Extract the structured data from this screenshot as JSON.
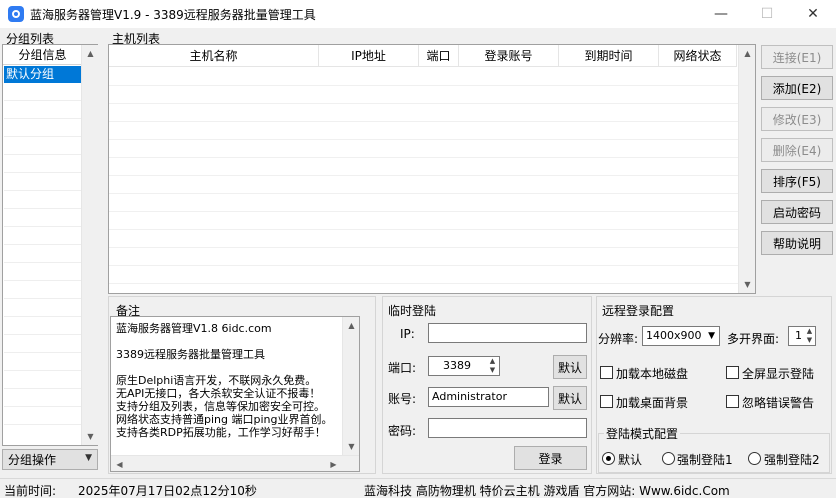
{
  "window": {
    "title": "蓝海服务器管理V1.9 - 3389远程服务器批量管理工具",
    "minimize": "—",
    "maximize": "☐",
    "close": "✕"
  },
  "groups": {
    "section_label": "分组列表",
    "column_header": "分组信息",
    "items": [
      "默认分组"
    ],
    "ops_label": "分组操作"
  },
  "hosts": {
    "section_label": "主机列表",
    "columns": [
      "主机名称",
      "IP地址",
      "端口",
      "登录账号",
      "到期时间",
      "网络状态"
    ]
  },
  "actions": {
    "connect": "连接(E1)",
    "add": "添加(E2)",
    "edit": "修改(E3)",
    "delete": "删除(E4)",
    "sort": "排序(F5)",
    "boot_password": "启动密码",
    "help": "帮助说明"
  },
  "notes": {
    "label": "备注",
    "lines": [
      "蓝海服务器管理V1.8 6idc.com",
      "",
      "3389远程服务器批量管理工具",
      "",
      "原生Delphi语言开发，不联网永久免费。",
      "无API无接口，各大杀软安全认证不报毒！",
      "支持分组及列表，信息等保加密安全可控。",
      "网络状态支持普通ping 端口ping业界首创。",
      "支持各类RDP拓展功能，工作学习好帮手！"
    ]
  },
  "temp_login": {
    "label": "临时登陆",
    "ip_label": "IP:",
    "ip_value": "",
    "port_label": "端口:",
    "port_value": "3389",
    "account_label": "账号:",
    "account_value": "Administrator",
    "password_label": "密码:",
    "password_value": "",
    "default_btn": "默认",
    "login_btn": "登录"
  },
  "remote_config": {
    "label": "远程登录配置",
    "resolution_label": "分辨率:",
    "resolution_value": "1400x900",
    "multi_label": "多开界面:",
    "multi_value": "1",
    "load_disk": "加载本地磁盘",
    "fullscreen": "全屏显示登陆",
    "load_bg": "加载桌面背景",
    "ignore_err": "忽略错误警告",
    "login_mode": {
      "label": "登陆模式配置",
      "options": [
        "默认",
        "强制登陆1",
        "强制登陆2"
      ],
      "selected": "默认"
    }
  },
  "status": {
    "time_label": "当前时间:",
    "time_value": "2025年07月17日02点12分10秒",
    "promo": "蓝海科技 高防物理机 特价云主机 游戏盾 官方网站: Www.6idc.Com"
  },
  "colors": {
    "selection": "#0078d7",
    "app_icon": "#2f7bf2"
  }
}
